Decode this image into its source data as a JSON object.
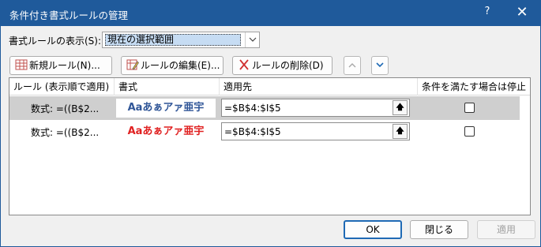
{
  "window": {
    "title": "条件付き書式ルールの管理",
    "help": "?",
    "close": "✕"
  },
  "scope": {
    "label": "書式ルールの表示(S):",
    "value": "現在の選択範囲"
  },
  "toolbar": {
    "new_rule": "新規ルール(N)...",
    "edit_rule": "ルールの編集(E)...",
    "delete_rule": "ルールの削除(D)",
    "move_up": "▲",
    "move_down": "▼"
  },
  "table": {
    "headers": [
      "ルール (表示順で適用)",
      "書式",
      "適用先",
      "条件を満たす場合は停止"
    ],
    "rows": [
      {
        "rule": "数式: =((B$2...",
        "preview": "Aaあぁアァ亜宇",
        "preview_color": "#2f5597",
        "applies_to": "=$B$4:$I$5",
        "stop": false,
        "selected": true
      },
      {
        "rule": "数式: =((B$2...",
        "preview": "Aaあぁアァ亜宇",
        "preview_color": "#e02020",
        "applies_to": "=$B$4:$I$5",
        "stop": false,
        "selected": false
      }
    ]
  },
  "buttons": {
    "ok": "OK",
    "close": "閉じる",
    "apply": "適用"
  },
  "colors": {
    "titlebar": "#1f5a9b",
    "selection": "#cfcfcf",
    "ok_border": "#1f6ab5"
  }
}
